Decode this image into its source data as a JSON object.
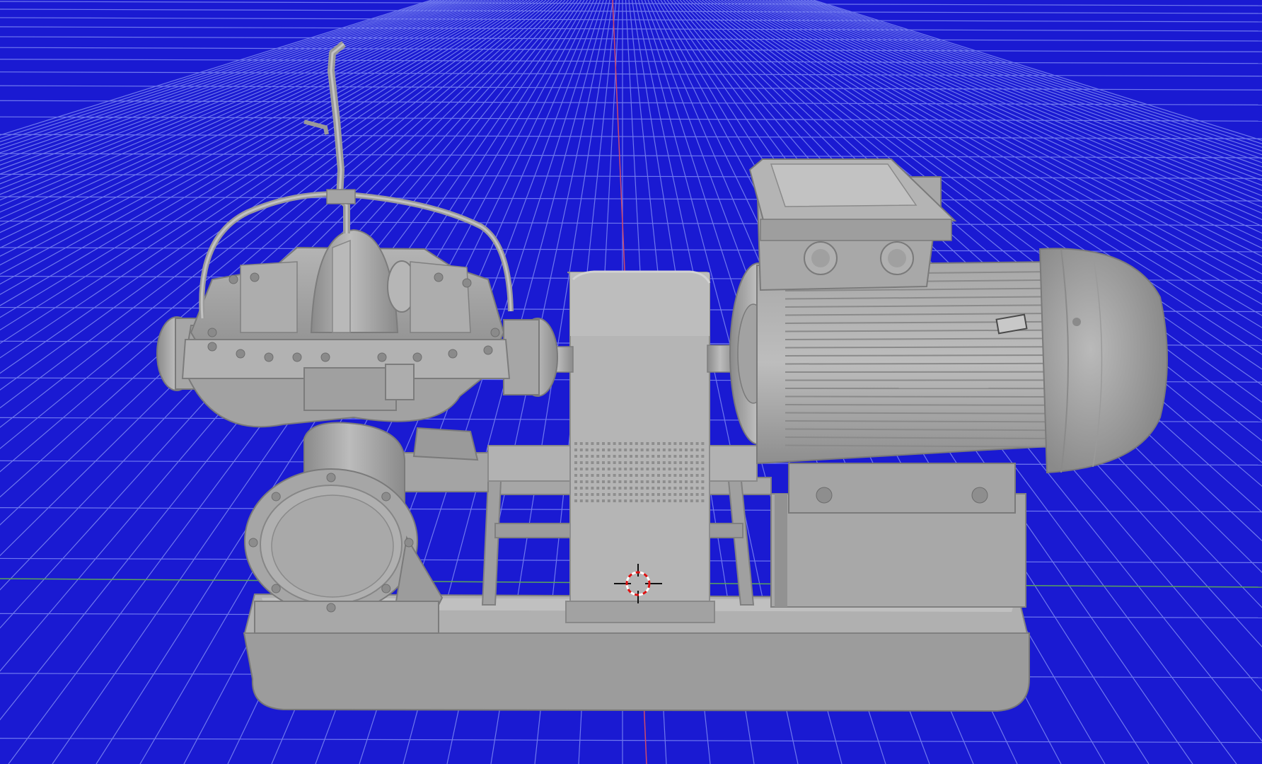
{
  "viewport": {
    "background_color": "#1a1ad2",
    "grid_line_color": "#6f78ee",
    "grid_major_color": "#9aa2f5",
    "axis_y_color": "#d04a6a",
    "axis_x_color": "#5aa45a",
    "model_color": "#9a9a9a",
    "model_shadow_color": "#6e6e6e",
    "model_highlight_color": "#bdbdbd",
    "view_mode": "perspective",
    "shading": "solid",
    "object": {
      "name": "split-case-pump-assembly",
      "parts": [
        "discharge-pipe",
        "bypass-tube",
        "pump-casing",
        "suction-flange",
        "coupling-guard",
        "electric-motor",
        "terminal-box",
        "motor-fan-cover",
        "base-frame"
      ]
    },
    "cursor": {
      "icon": "3d-cursor-icon"
    }
  }
}
